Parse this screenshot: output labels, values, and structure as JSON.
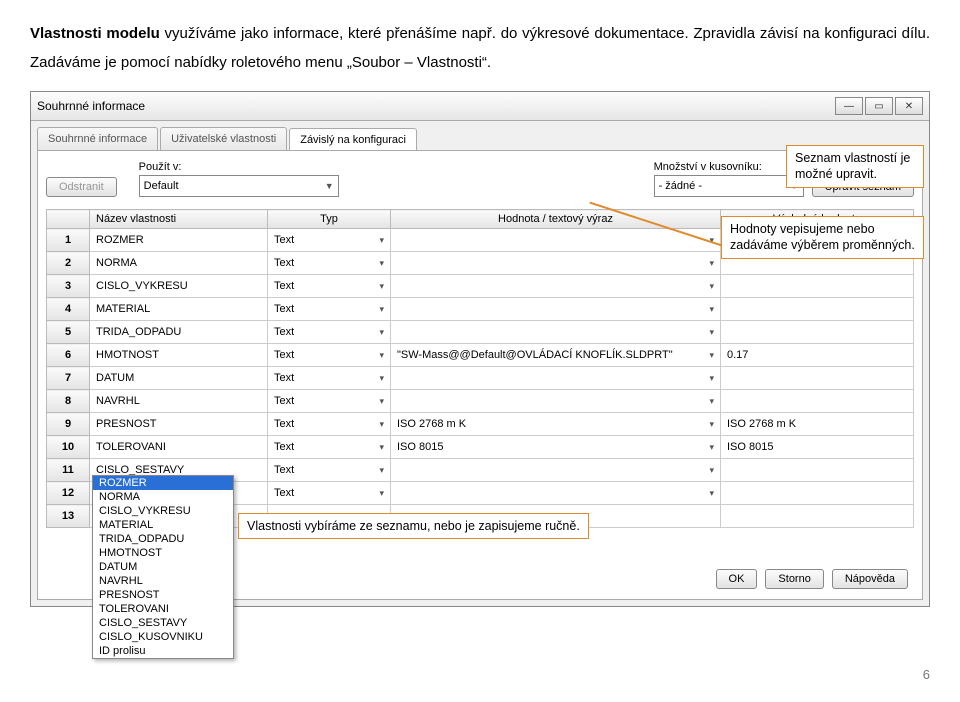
{
  "intro": {
    "bold": "Vlastnosti modelu",
    "rest1": " využíváme jako informace, které přenášíme např. do výkresové dokumentace. Zpravidla závisí na konfiguraci dílu. Zadáváme je pomocí nabídky roletového menu „Soubor – Vlastnosti“."
  },
  "dialog": {
    "title": "Souhrnné informace",
    "win_min": "—",
    "win_mid": "▭",
    "win_close": "✕",
    "tabs": [
      "Souhrnné informace",
      "Uživatelské vlastnosti",
      "Závislý na konfiguraci"
    ],
    "btn_remove": "Odstranit",
    "lbl_usein": "Použít v:",
    "combo_usein": "Default",
    "lbl_qty": "Množství v kusovníku:",
    "combo_qty": "- žádné -",
    "btn_editlist": "Upravit seznam",
    "headers": [
      "",
      "Název vlastnosti",
      "Typ",
      "Hodnota / textový výraz",
      "Výsledná hodnota"
    ],
    "rows": [
      {
        "n": "1",
        "name": "ROZMER",
        "typ": "Text",
        "hod": "",
        "vys": ""
      },
      {
        "n": "2",
        "name": "NORMA",
        "typ": "Text",
        "hod": "",
        "vys": ""
      },
      {
        "n": "3",
        "name": "CISLO_VYKRESU",
        "typ": "Text",
        "hod": "",
        "vys": ""
      },
      {
        "n": "4",
        "name": "MATERIAL",
        "typ": "Text",
        "hod": "",
        "vys": ""
      },
      {
        "n": "5",
        "name": "TRIDA_ODPADU",
        "typ": "Text",
        "hod": "",
        "vys": ""
      },
      {
        "n": "6",
        "name": "HMOTNOST",
        "typ": "Text",
        "hod": "\"SW-Mass@@Default@OVLÁDACÍ KNOFLÍK.SLDPRT\"",
        "vys": "0.17"
      },
      {
        "n": "7",
        "name": "DATUM",
        "typ": "Text",
        "hod": "",
        "vys": ""
      },
      {
        "n": "8",
        "name": "NAVRHL",
        "typ": "Text",
        "hod": "",
        "vys": ""
      },
      {
        "n": "9",
        "name": "PRESNOST",
        "typ": "Text",
        "hod": "ISO 2768 m K",
        "vys": "ISO 2768 m K"
      },
      {
        "n": "10",
        "name": "TOLEROVANI",
        "typ": "Text",
        "hod": "ISO 8015",
        "vys": "ISO 8015"
      },
      {
        "n": "11",
        "name": "CISLO_SESTAVY",
        "typ": "Text",
        "hod": "",
        "vys": ""
      },
      {
        "n": "12",
        "name": "CISLO_KUSOVNIKU",
        "typ": "Text",
        "hod": "",
        "vys": ""
      },
      {
        "n": "13",
        "name": "",
        "typ": "",
        "hod": "",
        "vys": ""
      }
    ],
    "autolist": [
      "ROZMER",
      "NORMA",
      "CISLO_VYKRESU",
      "MATERIAL",
      "TRIDA_ODPADU",
      "HMOTNOST",
      "DATUM",
      "NAVRHL",
      "PRESNOST",
      "TOLEROVANI",
      "CISLO_SESTAVY",
      "CISLO_KUSOVNIKU",
      "ID prolisu"
    ],
    "autolist_sel": 0,
    "btn_ok": "OK",
    "btn_storno": "Storno",
    "btn_help": "Nápověda"
  },
  "callouts": {
    "c1": "Seznam vlastností je možné upravit.",
    "c2": "Hodnoty vepisujeme nebo zadáváme výběrem proměnných.",
    "c3": "Vlastnosti vybíráme ze seznamu, nebo je zapisujeme ručně."
  },
  "pagenum": "6"
}
